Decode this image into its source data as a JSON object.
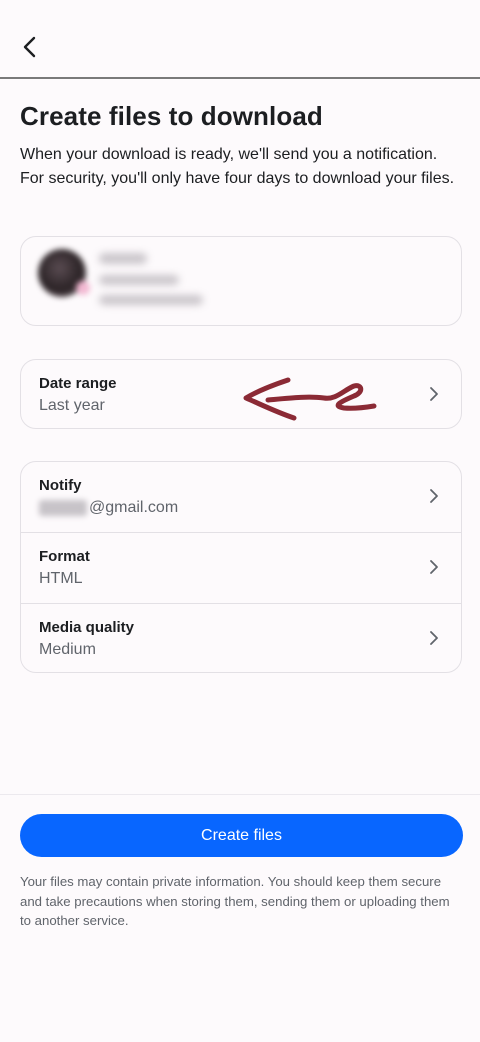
{
  "header": {
    "back_icon": "chevron-left-icon"
  },
  "page": {
    "title": "Create files to download",
    "subtitle": "When your download is ready, we'll send you a notification. For security, you'll only have four days to download your files."
  },
  "date_range": {
    "label": "Date range",
    "value": "Last year"
  },
  "notify": {
    "label": "Notify",
    "value": "@gmail.com"
  },
  "format": {
    "label": "Format",
    "value": "HTML"
  },
  "media_quality": {
    "label": "Media quality",
    "value": "Medium"
  },
  "footer": {
    "create_button_label": "Create files",
    "disclaimer": "Your files may contain private information. You should keep them secure and take precautions when storing them, sending them or uploading them to another service."
  },
  "colors": {
    "primary": "#0866ff",
    "annotation": "#8b2a35",
    "background": "#fdfafc"
  }
}
